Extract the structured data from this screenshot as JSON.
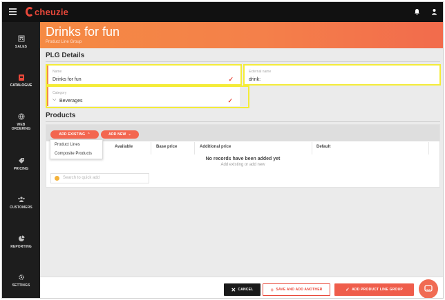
{
  "app": {
    "brand": "cheuzie"
  },
  "sidebar": {
    "items": [
      {
        "label": "SALES",
        "icon": "register-icon"
      },
      {
        "label": "CATALOGUE",
        "icon": "catalogue-icon",
        "active": true
      },
      {
        "label": "WEB ORDERING",
        "icon": "globe-icon"
      },
      {
        "label": "PRICING",
        "icon": "tag-icon"
      },
      {
        "label": "CUSTOMERS",
        "icon": "customers-icon"
      },
      {
        "label": "REPORTING",
        "icon": "pie-chart-icon"
      },
      {
        "label": "SETTINGS",
        "icon": "gear-icon"
      }
    ]
  },
  "header": {
    "title": "Drinks for fun",
    "subtitle": "Product Line Group"
  },
  "details": {
    "section_title": "PLG Details",
    "name": {
      "label": "Name",
      "value": "Drinks for fun"
    },
    "external_name": {
      "label": "External name",
      "value": "drink:"
    },
    "category": {
      "label": "Category",
      "value": "Beverages"
    }
  },
  "products": {
    "section_title": "Products",
    "add_existing_label": "ADD EXISTING",
    "add_new_label": "ADD NEW",
    "dropdown_items": [
      "Product Lines",
      "Composite Products"
    ],
    "columns": [
      "Available",
      "Base price",
      "Additional price",
      "Default"
    ],
    "empty_title": "No records have been added yet",
    "empty_subtitle": "Add existing or add new",
    "quick_add_placeholder": "Search to quick add"
  },
  "footer": {
    "cancel_label": "CANCEL",
    "save_another_label": "SAVE AND ADD ANOTHER",
    "add_group_label": "ADD PRODUCT LINE GROUP"
  },
  "colors": {
    "accent": "#f3664f",
    "header_start": "#f58a43",
    "highlight": "#f4ec38"
  }
}
